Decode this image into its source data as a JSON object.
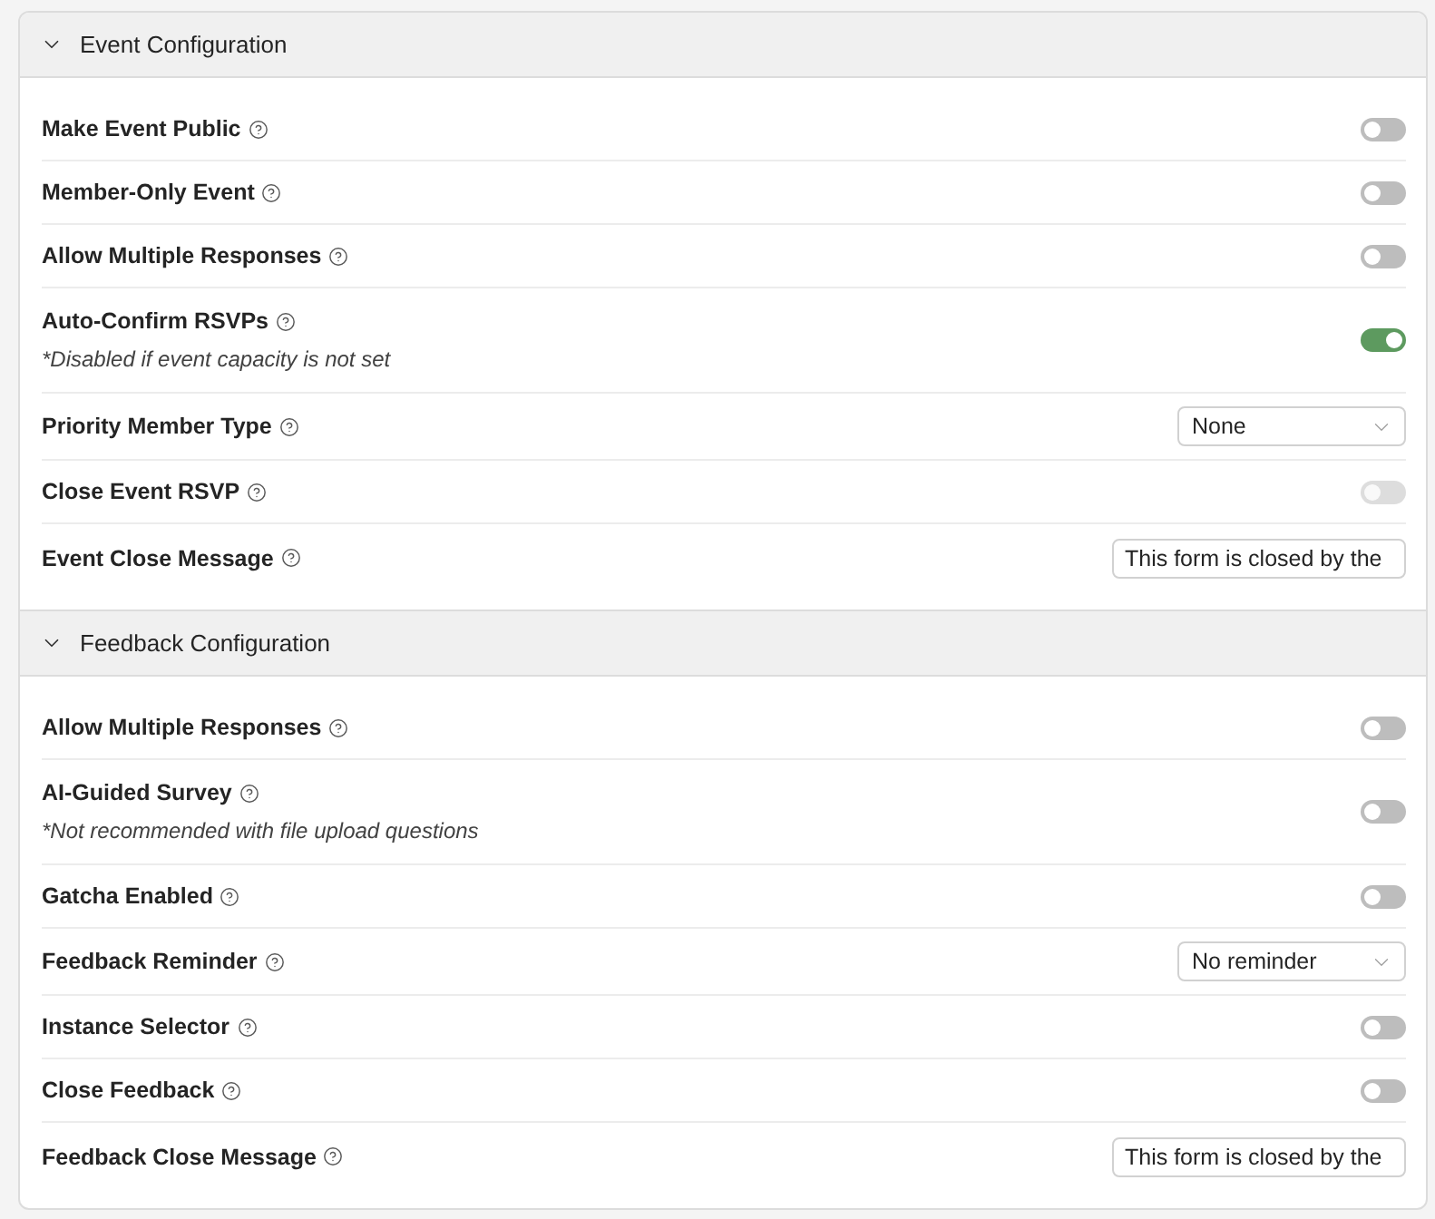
{
  "sections": [
    {
      "title": "Event Configuration",
      "expanded": true,
      "settings": [
        {
          "kind": "toggle",
          "label": "Make Event Public",
          "on": false,
          "disabled": false
        },
        {
          "kind": "toggle",
          "label": "Member-Only Event",
          "on": false,
          "disabled": false
        },
        {
          "kind": "toggle",
          "label": "Allow Multiple Responses",
          "on": false,
          "disabled": false
        },
        {
          "kind": "toggle",
          "label": "Auto-Confirm RSVPs",
          "note": "*Disabled if event capacity is not set",
          "on": true,
          "disabled": false
        },
        {
          "kind": "select",
          "label": "Priority Member Type",
          "value": "None"
        },
        {
          "kind": "toggle",
          "label": "Close Event RSVP",
          "on": false,
          "disabled": true
        },
        {
          "kind": "text",
          "label": "Event Close Message",
          "value": "This form is closed by the"
        }
      ]
    },
    {
      "title": "Feedback Configuration",
      "expanded": true,
      "settings": [
        {
          "kind": "toggle",
          "label": "Allow Multiple Responses",
          "on": false,
          "disabled": false
        },
        {
          "kind": "toggle",
          "label": "AI-Guided Survey",
          "note": "*Not recommended with file upload questions",
          "on": false,
          "disabled": false
        },
        {
          "kind": "toggle",
          "label": "Gatcha Enabled",
          "on": false,
          "disabled": false
        },
        {
          "kind": "select",
          "label": "Feedback Reminder",
          "value": "No reminder"
        },
        {
          "kind": "toggle",
          "label": "Instance Selector",
          "on": false,
          "disabled": false
        },
        {
          "kind": "toggle",
          "label": "Close Feedback",
          "on": false,
          "disabled": false
        },
        {
          "kind": "text",
          "label": "Feedback Close Message",
          "value": "This form is closed by the"
        }
      ]
    }
  ]
}
